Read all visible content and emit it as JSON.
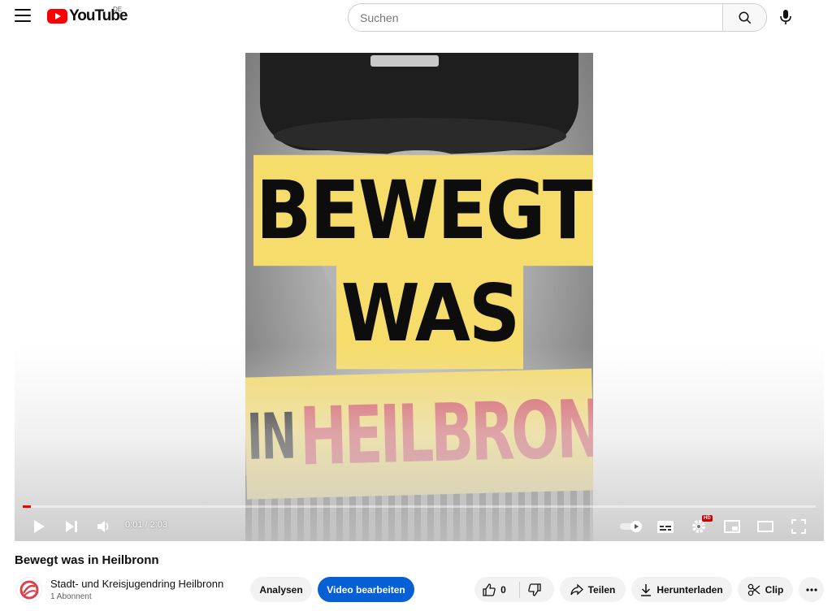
{
  "header": {
    "logo_text": "YouTube",
    "country_code": "DE",
    "search_placeholder": "Suchen"
  },
  "thumbnail": {
    "line1": "BEWEGT",
    "line2": "WAS",
    "line3_prefix": "IN",
    "line3_city": "HEILBRONN"
  },
  "player": {
    "time": "0:01 / 2:03",
    "progress": 0.008,
    "hd_badge": "HD"
  },
  "video": {
    "title": "Bewegt was in Heilbronn"
  },
  "channel": {
    "name": "Stadt- und Kreisjugendring Heilbronn",
    "subscribers": "1 Abonnent"
  },
  "actions": {
    "analytics_label": "Analysen",
    "edit_label": "Video bearbeiten",
    "like_count": "0",
    "share_label": "Teilen",
    "download_label": "Herunterladen",
    "clip_label": "Clip"
  },
  "colors": {
    "brand_red": "#ff0000",
    "edit_blue": "#065fd4",
    "band_yellow": "#f5dc6b",
    "city_red": "#d5535a"
  }
}
